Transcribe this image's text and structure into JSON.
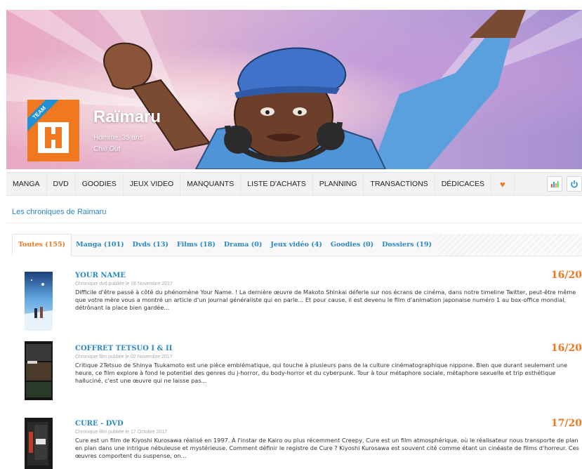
{
  "profile": {
    "name": "Raïmaru",
    "meta": "Homme, 35 ans",
    "mood": "Chill Out",
    "team_logo_text": "TEAM"
  },
  "nav": {
    "items": [
      "MANGA",
      "DVD",
      "GOODIES",
      "JEUX VIDEO",
      "MANQUANTS",
      "LISTE D'ACHATS",
      "PLANNING",
      "TRANSACTIONS",
      "DÉDICACES"
    ],
    "heart_icon": "heart-icon",
    "stats_icon": "stats-icon",
    "power_icon": "power-icon",
    "heart_glyph": "♥"
  },
  "section_title": "Les chroniques de Raimaru",
  "tabs": [
    {
      "label": "Toutes (155)",
      "active": true
    },
    {
      "label": "Manga (101)",
      "active": false
    },
    {
      "label": "Dvds (13)",
      "active": false
    },
    {
      "label": "Films (18)",
      "active": false
    },
    {
      "label": "Drama (0)",
      "active": false
    },
    {
      "label": "Jeux vidéo (4)",
      "active": false
    },
    {
      "label": "Goodies (0)",
      "active": false
    },
    {
      "label": "Dossiers (19)",
      "active": false
    }
  ],
  "reviews": [
    {
      "title": "YOUR NAME",
      "score": "16/20",
      "date": "Chronique dvd publiée le 06 Novembre 2017",
      "excerpt": "Difficile d'être passé à côté du phénomène Your Name. ! La dernière œuvre de Makoto Shinkai déferle sur nos écrans de cinéma, dans notre timeline Twitter, peut-être même que votre mère vous a montré un article d'un journal généraliste qui en parle... Et pour cause, il est devenu le film d'animation japonaise numéro 1 au box-office mondial, détrônant la place bien gardée..."
    },
    {
      "title": "COFFRET TETSUO I & II",
      "score": "16/20",
      "date": "Chronique film publiée le 02 Novembre 2017",
      "excerpt": "Critique 2Tetsuo de Shinya Tsukamoto est une pièce emblématique, qui touche à plusieurs pans de la culture cinématographique nippone. Bien que durant seulement une heure, ce film explore à fond le potentiel des genres du j-horror, du body-horror et du cyberpunk. Tour à tour métaphore sociale, métaphore sexuelle et trip esthétique halluciné, c'est une œuvre qui ne laisse pas..."
    },
    {
      "title": "CURE - DVD",
      "score": "17/20",
      "date": "Chronique film publiée le 17 Octobre 2017",
      "excerpt": "Cure est un film de Kiyoshi Kurosawa réalisé en 1997. À l'instar de Kairo ou plus récemment Creepy, Cure est un film atmosphérique, où le réalisateur nous transporte de plan en plan dans une intrigue nébuleuse et mystérieuse. Comment définir le registre de Cure ? Kiyoshi Kurosawa est souvent cité comme étant un cinéaste de films d'horreur. Ces œuvres comportent du suspense, on..."
    }
  ]
}
